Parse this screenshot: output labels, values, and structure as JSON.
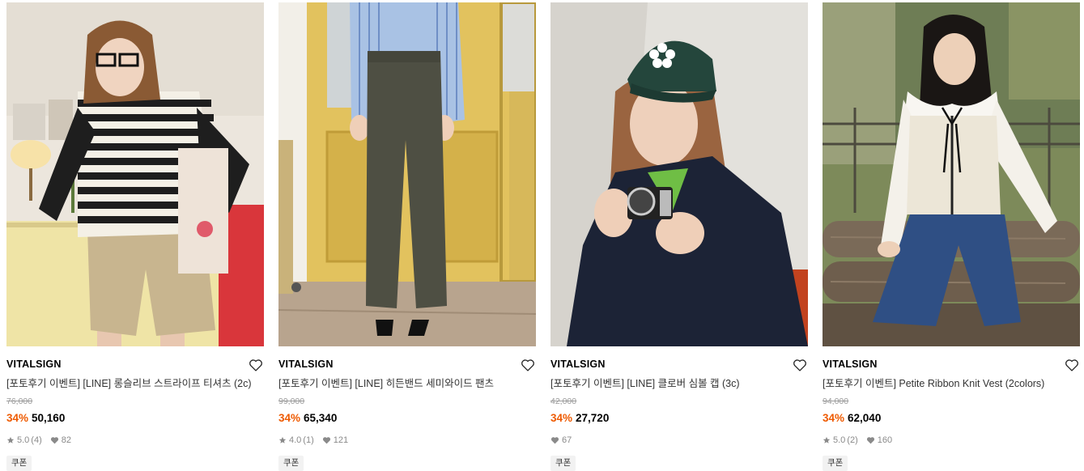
{
  "products": [
    {
      "brand": "VITALSIGN",
      "title": "[포토후기 이벤트] [LINE] 롱슬리브 스트라이프 티셔츠 (2c)",
      "original_price": "76,000",
      "discount": "34%",
      "price": "50,160",
      "rating": "5.0",
      "review_count": "(4)",
      "likes": "82",
      "coupon": "쿠폰",
      "like_icon": "heart-outline-icon"
    },
    {
      "brand": "VITALSIGN",
      "title": "[포토후기 이벤트] [LINE] 히든밴드 세미와이드 팬츠",
      "original_price": "99,000",
      "discount": "34%",
      "price": "65,340",
      "rating": "4.0",
      "review_count": "(1)",
      "likes": "121",
      "coupon": "쿠폰",
      "like_icon": "heart-outline-icon"
    },
    {
      "brand": "VITALSIGN",
      "title": "[포토후기 이벤트] [LINE] 클로버 심볼 캡 (3c)",
      "original_price": "42,000",
      "discount": "34%",
      "price": "27,720",
      "likes": "67",
      "coupon": "쿠폰",
      "like_icon": "heart-outline-icon"
    },
    {
      "brand": "VITALSIGN",
      "title": "[포토후기 이벤트] Petite Ribbon Knit Vest (2colors)",
      "original_price": "94,000",
      "discount": "34%",
      "price": "62,040",
      "rating": "5.0",
      "review_count": "(2)",
      "likes": "160",
      "coupon": "쿠폰",
      "like_icon": "heart-outline-icon"
    }
  ],
  "colors": {
    "discount": "#ee5a00",
    "muted": "#8a8a8a",
    "coupon_bg": "#f2f2f2"
  }
}
